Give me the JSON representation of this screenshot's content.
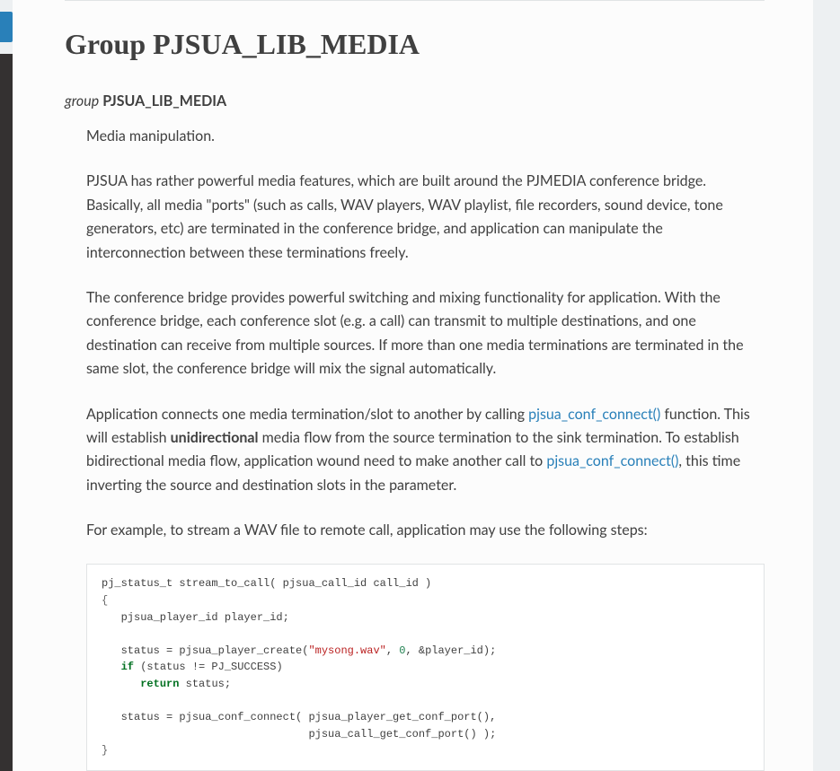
{
  "heading": "Group PJSUA_LIB_MEDIA",
  "group": {
    "keyword": "group",
    "name": "PJSUA_LIB_MEDIA"
  },
  "paragraphs": {
    "p1": "Media manipulation.",
    "p2": "PJSUA has rather powerful media features, which are built around the PJMEDIA conference bridge. Basically, all media \"ports\" (such as calls, WAV players, WAV playlist, file recorders, sound device, tone generators, etc) are terminated in the conference bridge, and application can manipulate the interconnection between these terminations freely.",
    "p3": "The conference bridge provides powerful switching and mixing functionality for application. With the conference bridge, each conference slot (e.g. a call) can transmit to multiple destinations, and one destination can receive from multiple sources. If more than one media terminations are terminated in the same slot, the conference bridge will mix the signal automatically.",
    "p4_a": "Application connects one media termination/slot to another by calling ",
    "p4_link1": "pjsua_conf_connect()",
    "p4_b": " function. This will establish ",
    "p4_strong": "unidirectional",
    "p4_c": " media flow from the source termination to the sink termination. To establish bidirectional media flow, application wound need to make another call to ",
    "p4_link2": "pjsua_conf_connect()",
    "p4_d": ", this time inverting the source and destination slots in the parameter.",
    "p5": "For example, to stream a WAV file to remote call, application may use the following steps:"
  },
  "code": {
    "l1_a": "pj_status_t stream_to_call( pjsua_call_id call_id )",
    "l2": "{",
    "l3": "   pjsua_player_id player_id;",
    "blank1": "",
    "l5_a": "   status = pjsua_player_create(",
    "l5_str": "\"mysong.wav\"",
    "l5_b": ", ",
    "l5_num": "0",
    "l5_c": ", &player_id);",
    "l6_a": "   ",
    "l6_kw": "if",
    "l6_b": " (status != PJ_SUCCESS)",
    "l7_a": "      ",
    "l7_kw": "return",
    "l7_b": " status;",
    "blank2": "",
    "l9": "   status = pjsua_conf_connect( pjsua_player_get_conf_port(),",
    "l10": "                                pjsua_call_get_conf_port() );",
    "l11": "}"
  }
}
